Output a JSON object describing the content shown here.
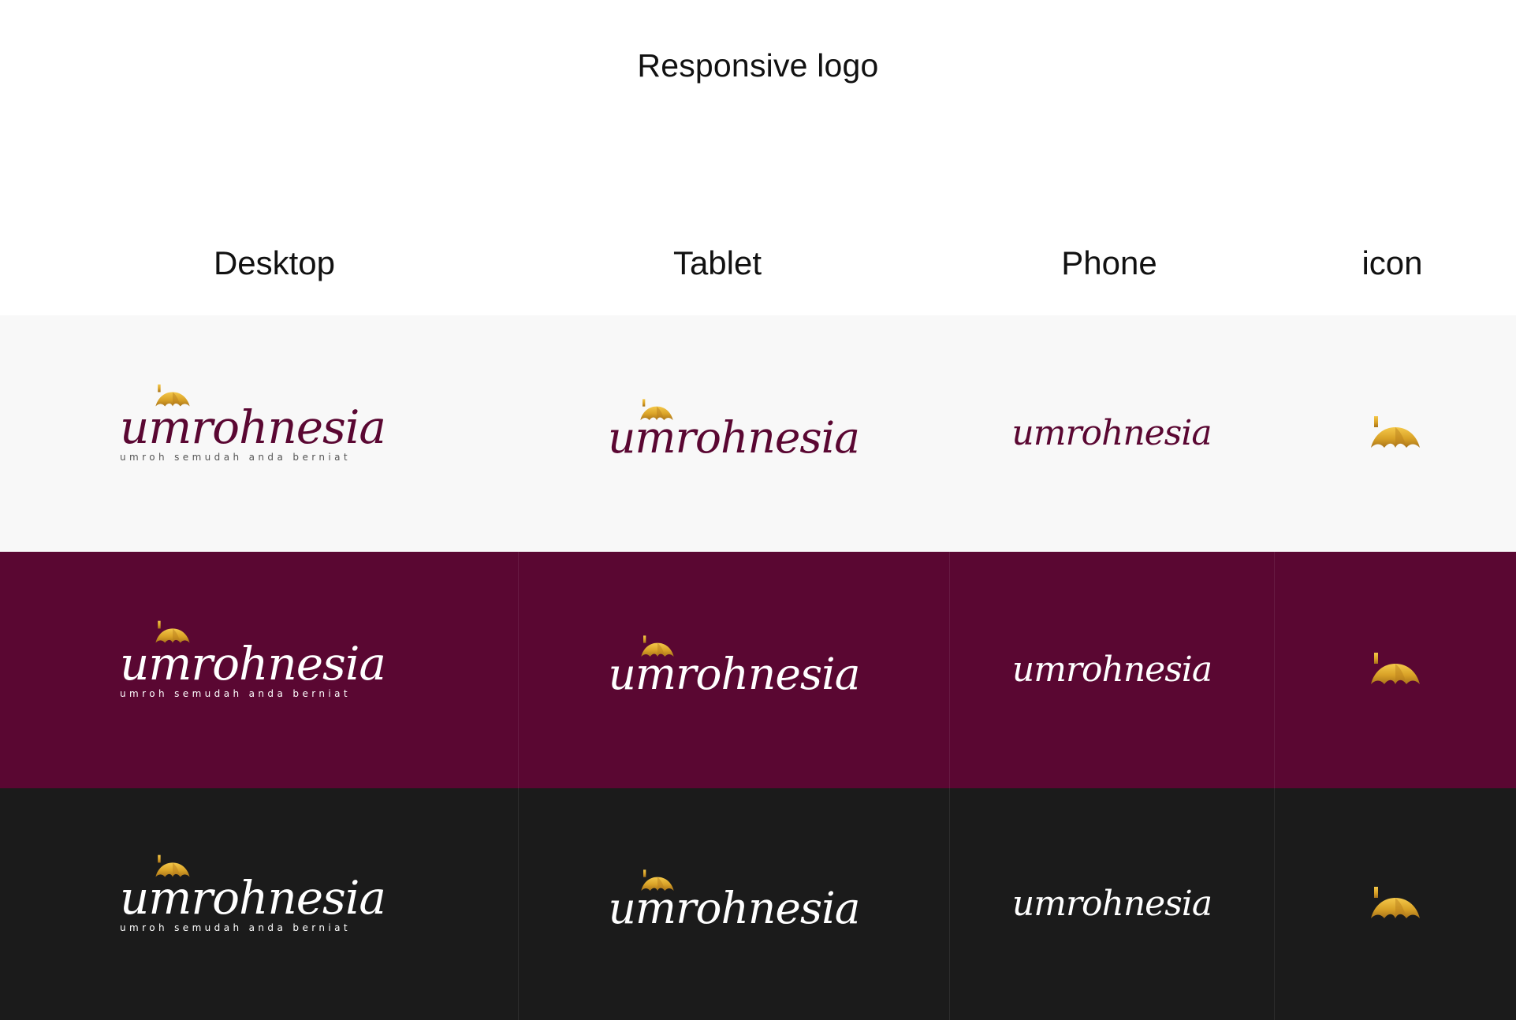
{
  "title": "Responsive logo",
  "columns": [
    "Desktop",
    "Tablet",
    "Phone",
    "icon"
  ],
  "logo": {
    "wordmark": "umrohnesia",
    "tagline": "umroh semudah anda berniat"
  },
  "icons": {
    "dome": "dome-icon"
  },
  "colors": {
    "brand_maroon": "#5a0732",
    "gold": "#d9a227",
    "light_band": "#f8f8f8",
    "maroon_band": "#5a0732",
    "dark_band": "#1b1b1b",
    "text_on_dark": "#ffffff"
  },
  "variants": [
    {
      "background": "light",
      "text_color": "#5a0732",
      "tagline_color": "#555555"
    },
    {
      "background": "maroon",
      "text_color": "#ffffff",
      "tagline_color": "#ffffff"
    },
    {
      "background": "dark",
      "text_color": "#ffffff",
      "tagline_color": "#ffffff"
    }
  ]
}
